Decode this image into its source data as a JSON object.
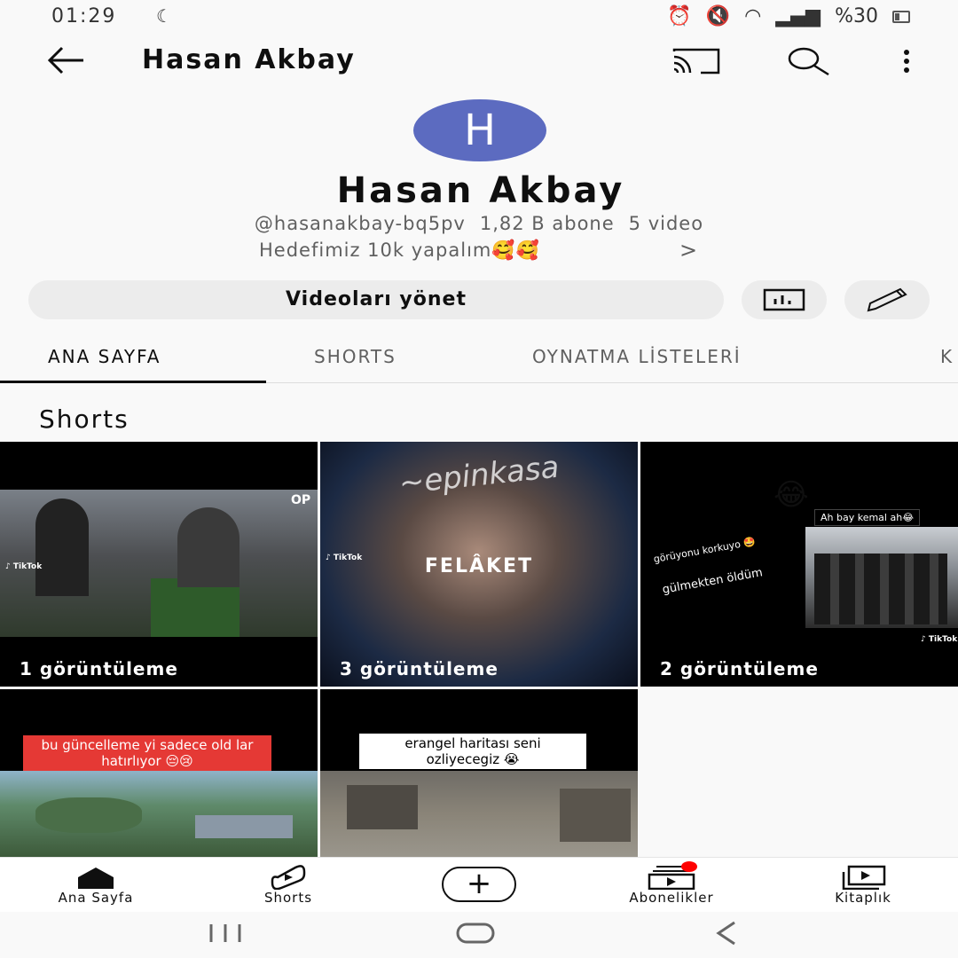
{
  "status": {
    "time": "01:29",
    "battery": "%30"
  },
  "app_bar": {
    "title": "Hasan Akbay",
    "back_icon": "arrow-left-icon",
    "cast_icon": "cast-icon",
    "search_icon": "search-icon",
    "more_icon": "more-vert-icon"
  },
  "channel": {
    "avatar_letter": "H",
    "avatar_color": "#5c6bc0",
    "name": "Hasan Akbay",
    "handle": "@hasanakbay-bq5pv",
    "subscribers": "1,82 B abone",
    "videos": "5 video",
    "description": "Hedefimiz 10k yapalım🥰🥰",
    "manage_label": "Videoları yönet"
  },
  "tabs": [
    {
      "label": "ANA SAYFA",
      "active": true
    },
    {
      "label": "SHORTS",
      "active": false
    },
    {
      "label": "OYNATMA LİSTELERİ",
      "active": false
    },
    {
      "label": "K",
      "active": false
    }
  ],
  "section": {
    "title": "Shorts"
  },
  "shorts": [
    {
      "views": "1 görüntüleme"
    },
    {
      "views": "3 görüntüleme",
      "overlay": "FELÂKET"
    },
    {
      "views": "2 görüntüleme",
      "caption_top": "Ah bay kemal ah😂",
      "caption_side_1": "görüyonu korkuyo 🤩",
      "caption_side_2": "gülmekten öldüm"
    },
    {
      "caption": "bu güncelleme yi sadece old lar hatırlıyor 😔😢"
    },
    {
      "caption": "erangel haritası seni ozliyecegiz 😭"
    }
  ],
  "bottom_nav": [
    {
      "label": "Ana Sayfa",
      "icon": "home-icon"
    },
    {
      "label": "Shorts",
      "icon": "shorts-icon"
    },
    {
      "label": "",
      "icon": "add-icon"
    },
    {
      "label": "Abonelikler",
      "icon": "subscriptions-icon"
    },
    {
      "label": "Kitaplık",
      "icon": "library-icon"
    }
  ],
  "colors": {
    "accent_red": "#ff0000",
    "chip_bg": "#ececec"
  }
}
